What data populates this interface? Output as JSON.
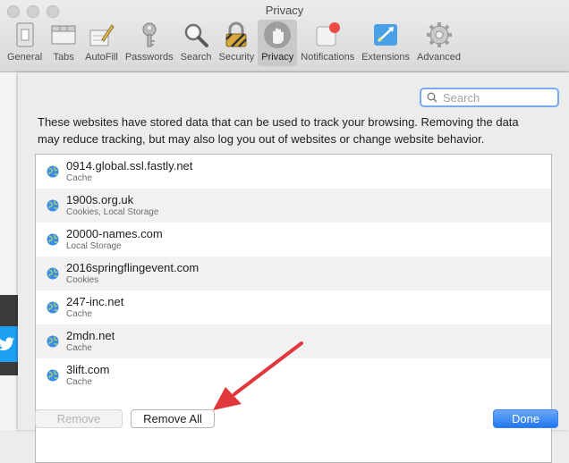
{
  "window": {
    "title": "Privacy"
  },
  "toolbar": [
    {
      "label": "General",
      "icon": "general-icon"
    },
    {
      "label": "Tabs",
      "icon": "tabs-icon"
    },
    {
      "label": "AutoFill",
      "icon": "autofill-icon"
    },
    {
      "label": "Passwords",
      "icon": "key-icon"
    },
    {
      "label": "Search",
      "icon": "magnifier-icon"
    },
    {
      "label": "Security",
      "icon": "lock-icon"
    },
    {
      "label": "Privacy",
      "icon": "hand-icon",
      "active": true
    },
    {
      "label": "Notifications",
      "icon": "notification-icon"
    },
    {
      "label": "Extensions",
      "icon": "extensions-icon"
    },
    {
      "label": "Advanced",
      "icon": "gear-icon"
    }
  ],
  "search": {
    "placeholder": "Search"
  },
  "description": "These websites have stored data that can be used to track your browsing. Removing the data may reduce tracking, but may also log you out of websites or change website behavior.",
  "websites": [
    {
      "name": "0914.global.ssl.fastly.net",
      "data": "Cache"
    },
    {
      "name": "1900s.org.uk",
      "data": "Cookies, Local Storage"
    },
    {
      "name": "20000-names.com",
      "data": "Local Storage"
    },
    {
      "name": "2016springflingevent.com",
      "data": "Cookies"
    },
    {
      "name": "247-inc.net",
      "data": "Cache"
    },
    {
      "name": "2mdn.net",
      "data": "Cache"
    },
    {
      "name": "3lift.com",
      "data": "Cache"
    }
  ],
  "buttons": {
    "remove": "Remove",
    "remove_all": "Remove All",
    "done": "Done"
  },
  "colors": {
    "accent": "#2b7cf0",
    "arrow": "#e0373a"
  }
}
